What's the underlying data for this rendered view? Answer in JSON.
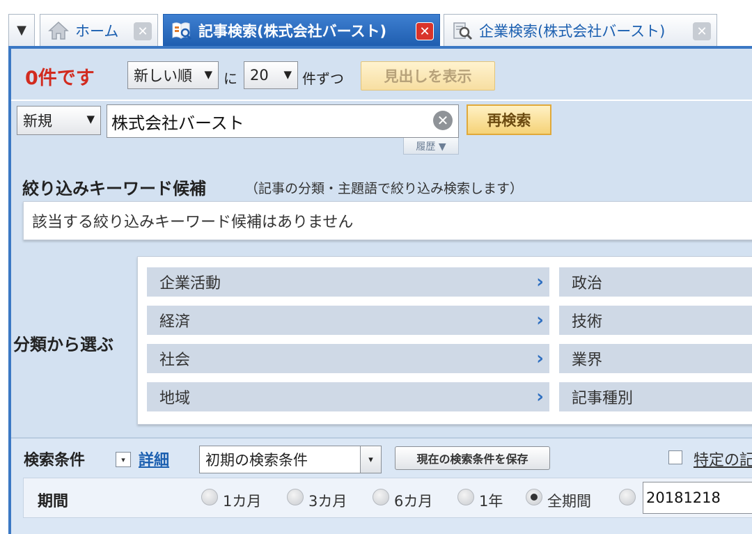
{
  "tabs": {
    "menu_glyph": "▼",
    "home": {
      "label": "ホーム",
      "close": "✕"
    },
    "article": {
      "label": "記事検索(株式会社バースト)",
      "close": "✕"
    },
    "company": {
      "label": "企業検索(株式会社バースト)",
      "close": "✕"
    }
  },
  "result": {
    "count_text": "0件です",
    "sort_value": "新しい順",
    "ni": "に",
    "per_page_value": "20",
    "kenzutsu": "件ずつ",
    "headline_button": "見出しを表示"
  },
  "search": {
    "mode_value": "新規",
    "query": "株式会社バースト",
    "clear_glyph": "✕",
    "research_button": "再検索",
    "history_button": "履歴 ▼"
  },
  "refine": {
    "title": "絞り込みキーワード候補",
    "description": "（記事の分類・主題語で絞り込み検索します）",
    "empty_message": "該当する絞り込みキーワード候補はありません"
  },
  "categories": {
    "label": "分類から選ぶ",
    "chevron": "›",
    "left": [
      "企業活動",
      "経済",
      "社会",
      "地域"
    ],
    "right": [
      "政治",
      "技術",
      "業界",
      "記事種別"
    ]
  },
  "conditions": {
    "title": "検索条件",
    "toggle_glyph": "▾",
    "detail_link": "詳細",
    "preset_value": "初期の検索条件",
    "preset_arrow": "▾",
    "save_button": "現在の検索条件を保存",
    "specific_label": "特定の記"
  },
  "period": {
    "label": "期間",
    "options": [
      "1カ月",
      "3カ月",
      "6カ月",
      "1年",
      "全期間"
    ],
    "selected": "全期間",
    "date_from": "20181218"
  },
  "colors": {
    "accent_blue": "#3b78c4",
    "count_red": "#d22b1f",
    "panel_bg": "#d3e1f1"
  }
}
